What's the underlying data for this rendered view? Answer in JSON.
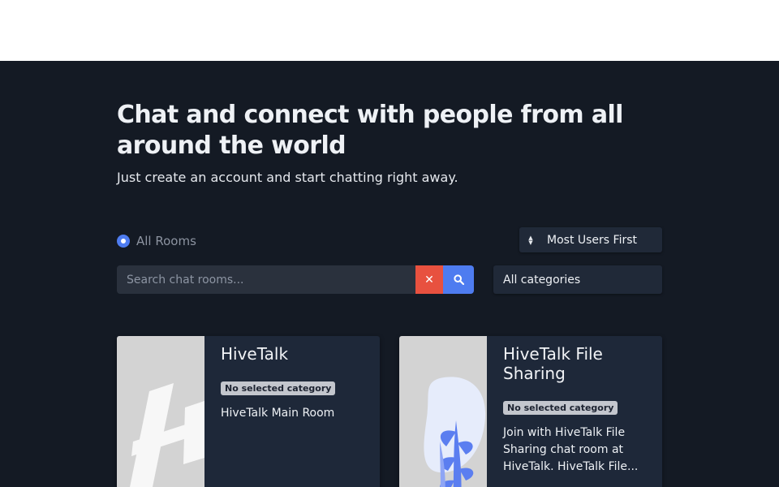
{
  "hero": {
    "title": "Chat and connect with people from all around the world",
    "subtitle": "Just create an account and start chatting right away."
  },
  "filters": {
    "scope_label": "All Rooms",
    "sort_label": "Most Users First",
    "search_placeholder": "Search chat rooms...",
    "category_label": "All categories"
  },
  "colors": {
    "primary": "#4e7cf0",
    "danger": "#e8513f",
    "background": "#141a24",
    "card": "#1e2839"
  },
  "rooms": [
    {
      "name": "HiveTalk",
      "category": "No selected category",
      "description": "HiveTalk Main Room"
    },
    {
      "name": "HiveTalk File Sharing",
      "category": "No selected category",
      "description": "Join with HiveTalk File Sharing chat room at HiveTalk. HiveTalk File..."
    }
  ]
}
